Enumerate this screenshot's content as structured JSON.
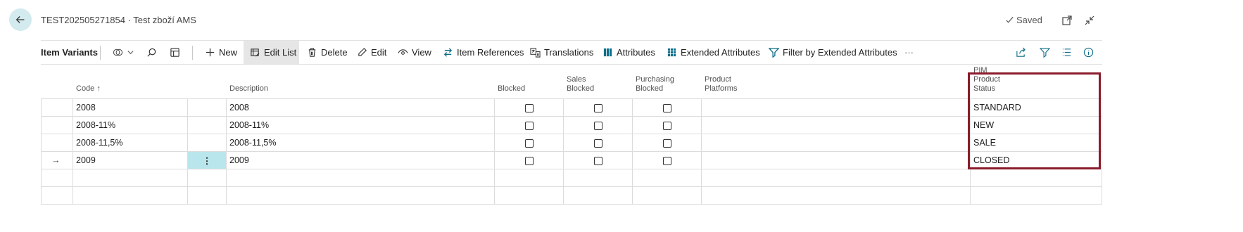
{
  "header": {
    "title": "TEST202505271854 · Test zboží AMS",
    "saved_label": "Saved",
    "saved_icon": "checkmark-icon",
    "icons": [
      "back-arrow-icon",
      "open-new-window-icon",
      "collapse-icon"
    ]
  },
  "toolbar": {
    "title": "Item Variants",
    "items": [
      {
        "label": "New",
        "icon": "plus-icon"
      },
      {
        "label": "Edit List",
        "icon": "edit-list-icon"
      },
      {
        "label": "Delete",
        "icon": "trash-icon"
      },
      {
        "label": "Edit",
        "icon": "pencil-icon"
      },
      {
        "label": "View",
        "icon": "eye-icon"
      },
      {
        "label": "Item References",
        "icon": "arrows-icon"
      },
      {
        "label": "Translations",
        "icon": "translate-icon"
      },
      {
        "label": "Attributes",
        "icon": "grid-icon"
      },
      {
        "label": "Extended Attributes",
        "icon": "grid-icon"
      },
      {
        "label": "Filter by Extended Attributes",
        "icon": "filter-icon"
      }
    ],
    "more_label": "···"
  },
  "grid": {
    "columns": {
      "code": "Code",
      "description": "Description",
      "blocked": "Blocked",
      "sales_blocked": "Sales Blocked",
      "purchasing_blocked_1": "Purchasing",
      "purchasing_blocked_2": "Blocked",
      "product_platforms": "Product Platforms",
      "pim_product_status": "PIM Product Status"
    },
    "sort_indicator": "↑",
    "rows": [
      {
        "code": "2008",
        "description": "2008",
        "blocked": false,
        "sales_blocked": false,
        "purchasing_blocked": false,
        "product_platforms": "",
        "pim_product_status": "STANDARD"
      },
      {
        "code": "2008-11%",
        "description": "2008-11%",
        "blocked": false,
        "sales_blocked": false,
        "purchasing_blocked": false,
        "product_platforms": "",
        "pim_product_status": "NEW"
      },
      {
        "code": "2008-11,5%",
        "description": "2008-11,5%",
        "blocked": false,
        "sales_blocked": false,
        "purchasing_blocked": false,
        "product_platforms": "",
        "pim_product_status": "SALE"
      },
      {
        "code": "2009",
        "description": "2009",
        "blocked": false,
        "sales_blocked": false,
        "purchasing_blocked": false,
        "product_platforms": "",
        "pim_product_status": "CLOSED"
      }
    ],
    "current_row_marker": "→",
    "row_menu_glyph": "⋮",
    "highlight_color": "#8a1c2b",
    "selected_cell_color": "#b9e6ec"
  }
}
